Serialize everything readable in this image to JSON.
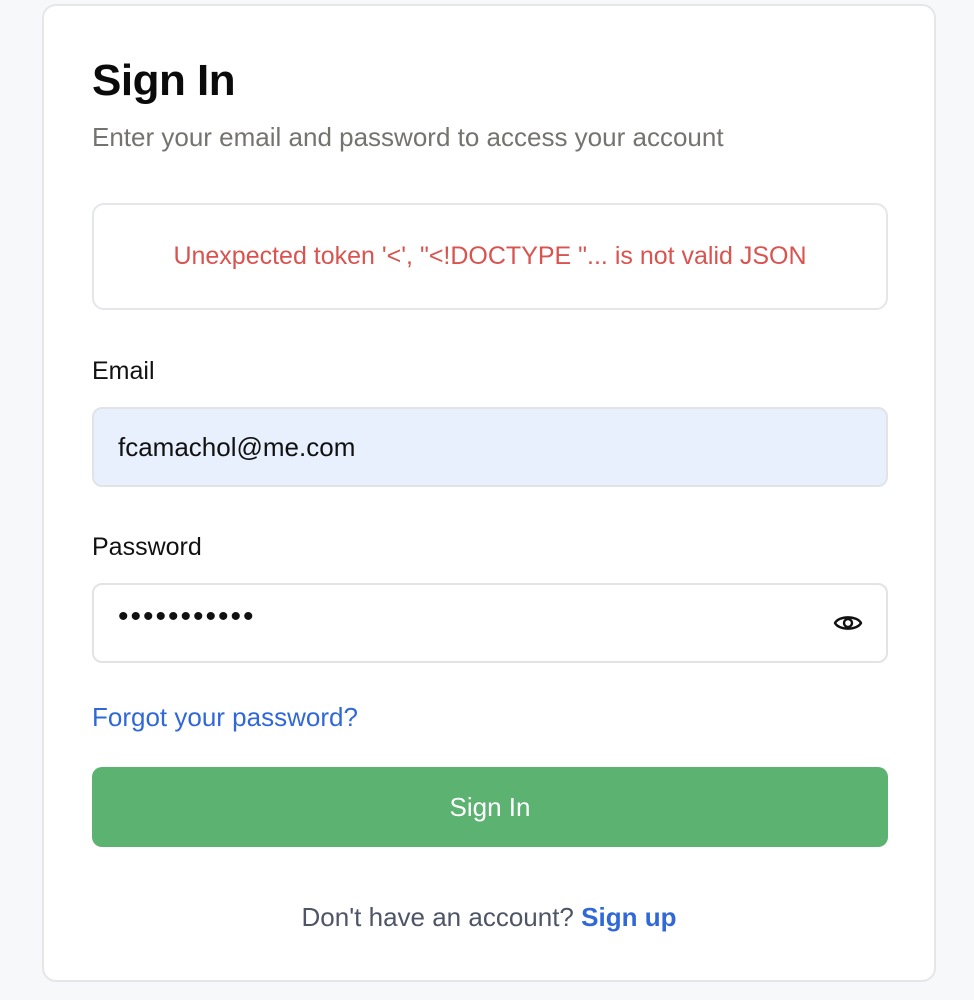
{
  "form": {
    "title": "Sign In",
    "subtitle": "Enter your email and password to access your account",
    "error_message": "Unexpected token '<', \"<!DOCTYPE \"... is not valid JSON",
    "email_label": "Email",
    "email_value": "fcamachol@me.com",
    "password_label": "Password",
    "password_masked": "•••••••••••",
    "show_password_icon": "eye-icon",
    "forgot_link": "Forgot your password?",
    "submit_label": "Sign In",
    "signup_prompt": "Don't have an account?",
    "signup_link": "Sign up"
  },
  "colors": {
    "error": "#d9534f",
    "link": "#3168d8",
    "button": "#5bb271",
    "autofill_bg": "#e8f0fe"
  }
}
